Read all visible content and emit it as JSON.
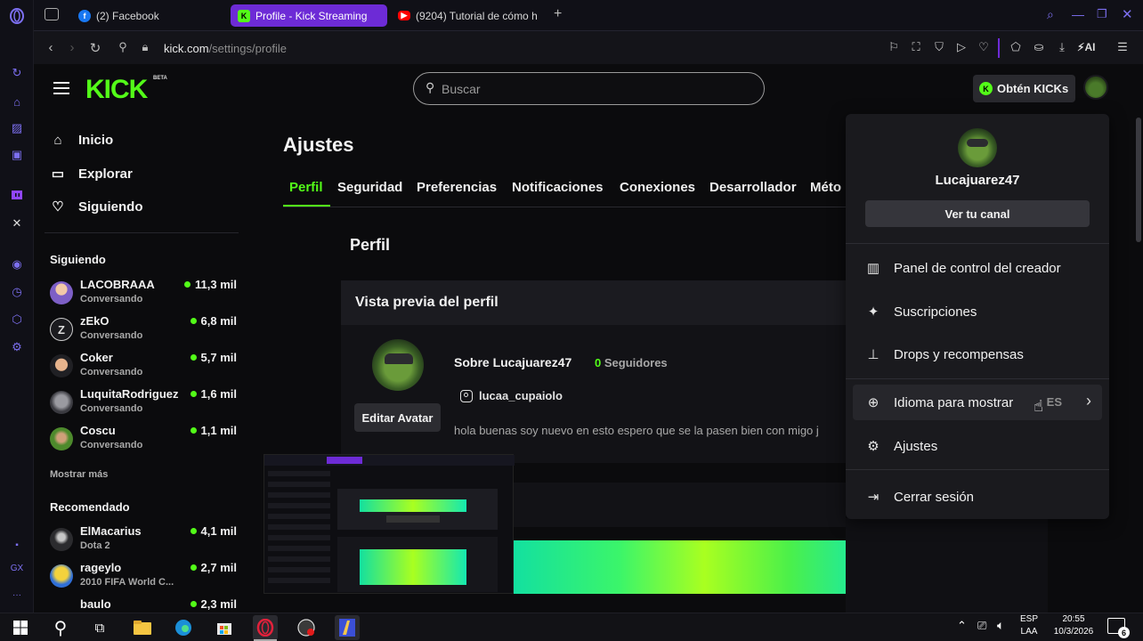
{
  "browser": {
    "tabs": [
      {
        "title": "(2) Facebook",
        "icon": "facebook-icon"
      },
      {
        "title": "Profile - Kick Streaming",
        "icon": "kick-icon",
        "active": true
      },
      {
        "title": "(9204) Tutorial de cómo h",
        "icon": "youtube-icon"
      }
    ],
    "new_tab": "+",
    "url_domain": "kick.com",
    "url_path": "/settings/profile",
    "aria_label": "AI"
  },
  "header": {
    "logo": "KICK",
    "beta": "BETA",
    "search_placeholder": "Buscar",
    "get_kicks": "Obtén KICKs"
  },
  "sidebar": {
    "nav": [
      {
        "label": "Inicio",
        "icon": "home-icon"
      },
      {
        "label": "Explorar",
        "icon": "browse-icon"
      },
      {
        "label": "Siguiendo",
        "icon": "heart-icon"
      }
    ],
    "following_title": "Siguiendo",
    "following": [
      {
        "name": "LACOBRAAA",
        "status": "Conversando",
        "viewers": "11,3 mil"
      },
      {
        "name": "zEkO",
        "status": "Conversando",
        "viewers": "6,8 mil"
      },
      {
        "name": "Coker",
        "status": "Conversando",
        "viewers": "5,7 mil"
      },
      {
        "name": "LuquitaRodriguez",
        "status": "Conversando",
        "viewers": "1,6 mil"
      },
      {
        "name": "Coscu",
        "status": "Conversando",
        "viewers": "1,1 mil"
      }
    ],
    "show_more": "Mostrar más",
    "recommended_title": "Recomendado",
    "recommended": [
      {
        "name": "ElMacarius",
        "status": "Dota 2",
        "viewers": "4,1 mil"
      },
      {
        "name": "rageylo",
        "status": "2010 FIFA World C...",
        "viewers": "2,7 mil"
      },
      {
        "name": "baulo",
        "status": "",
        "viewers": "2,3 mil"
      }
    ]
  },
  "settings": {
    "title": "Ajustes",
    "tabs": [
      "Perfil",
      "Seguridad",
      "Preferencias",
      "Notificaciones",
      "Conexiones",
      "Desarrollador",
      "Méto"
    ],
    "section_title": "Perfil",
    "preview_title": "Vista previa del perfil",
    "about": "Sobre Lucajuarez47",
    "followers_count": "0",
    "followers_label": "Seguidores",
    "instagram": "lucaa_cupaiolo",
    "edit_avatar": "Editar Avatar",
    "bio": "hola buenas soy nuevo en esto espero que se la pasen bien con migo j"
  },
  "user_menu": {
    "username": "Lucajuarez47",
    "view_channel": "Ver tu canal",
    "items": [
      {
        "label": "Panel de control del creador",
        "icon": "chart-icon"
      },
      {
        "label": "Suscripciones",
        "icon": "sparkle-icon"
      },
      {
        "label": "Drops y recompensas",
        "icon": "drops-icon"
      },
      {
        "label": "Idioma para mostrar",
        "icon": "globe-icon",
        "value": "ES"
      },
      {
        "label": "Ajustes",
        "icon": "gear-icon"
      },
      {
        "label": "Cerrar sesión",
        "icon": "logout-icon"
      }
    ]
  },
  "taskbar": {
    "lang_top": "ESP",
    "lang_bottom": "LAA",
    "time": "20:55",
    "date": "10/3/2026",
    "notif_count": "6"
  },
  "colors": {
    "accent": "#53fc18",
    "tab_active": "#6d2bd6",
    "menu_bg": "#1a1a1e"
  }
}
